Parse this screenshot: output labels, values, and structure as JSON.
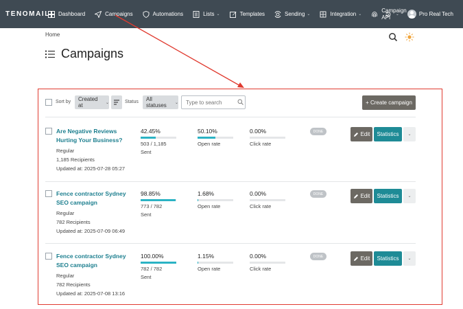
{
  "brand": "TENOMAIL",
  "nav": {
    "dashboard": "Dashboard",
    "campaigns": "Campaigns",
    "automations": "Automations",
    "lists": "Lists",
    "templates": "Templates",
    "sending": "Sending",
    "integration": "Integration",
    "campaign_api_1": "Campaign",
    "campaign_api_2": "API",
    "caret": "⌄"
  },
  "user": {
    "name": "Pro Real Tech"
  },
  "breadcrumb": "Home",
  "page_title": "Campaigns",
  "toolbar": {
    "sort_by_label": "Sort by",
    "sort_value": "Created at",
    "status_label": "Status",
    "status_value": "All statuses",
    "search_placeholder": "Type to search",
    "create_label": "+ Create campaign"
  },
  "campaigns": [
    {
      "title": "Are Negative Reviews Hurting Your Business?",
      "type": "Regular",
      "recipients": "1,185 Recipients",
      "updated": "Updated at: 2025-07-28 05:27",
      "sent_pct": "42.45%",
      "sent_fraction": 0.4245,
      "sent_count": "503 / 1,185",
      "sent_label": "Sent",
      "open_pct": "50.10%",
      "open_fraction": 0.501,
      "open_label": "Open rate",
      "click_pct": "0.00%",
      "click_fraction": 0.0,
      "click_label": "Click rate",
      "status": "DONE",
      "edit_label": "Edit",
      "stats_label": "Statistics"
    },
    {
      "title": "Fence contractor Sydney SEO campaign",
      "type": "Regular",
      "recipients": "782 Recipients",
      "updated": "Updated at: 2025-07-09 06:49",
      "sent_pct": "98.85%",
      "sent_fraction": 0.9885,
      "sent_count": "773 / 782",
      "sent_label": "Sent",
      "open_pct": "1.68%",
      "open_fraction": 0.0168,
      "open_label": "Open rate",
      "click_pct": "0.00%",
      "click_fraction": 0.0,
      "click_label": "Click rate",
      "status": "DONE",
      "edit_label": "Edit",
      "stats_label": "Statistics"
    },
    {
      "title": "Fence contractor Sydney SEO campaign",
      "type": "Regular",
      "recipients": "782 Recipients",
      "updated": "Updated at: 2025-07-08 13:16",
      "sent_pct": "100.00%",
      "sent_fraction": 1.0,
      "sent_count": "782 / 782",
      "sent_label": "Sent",
      "open_pct": "1.15%",
      "open_fraction": 0.0115,
      "open_label": "Open rate",
      "click_pct": "0.00%",
      "click_fraction": 0.0,
      "click_label": "Click rate",
      "status": "DONE",
      "edit_label": "Edit",
      "stats_label": "Statistics"
    }
  ],
  "colors": {
    "topbar": "#3f4a53",
    "accent": "#1e8b96",
    "progress": "#2bb3c4",
    "annotation": "#e03a2f",
    "link": "#1d7f8f"
  }
}
